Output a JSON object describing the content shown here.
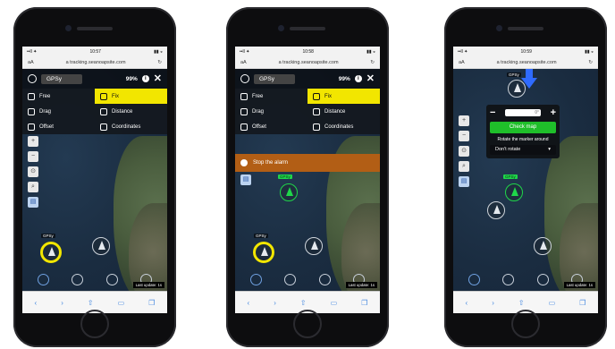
{
  "status_bar": {
    "carrier": "••ll ✦",
    "time": "10:57",
    "battery": "▮▮ ◒"
  },
  "status_bar_2": {
    "carrier": "••ll ✦",
    "time": "10:58",
    "battery": "▮▮ ◒"
  },
  "status_bar_3": {
    "carrier": "••ll ✦",
    "time": "10:59",
    "battery": "▮▮ ◒"
  },
  "url": {
    "aa": "aA",
    "text": "a tracking.seanoapsite.com",
    "reload": "↻"
  },
  "topbar": {
    "device": "GPSy",
    "battery": "99%",
    "info": "i",
    "close": "✕"
  },
  "menu": {
    "free": "Free",
    "fix": "Fix",
    "drag": "Drag",
    "distance": "Distance",
    "offset": "Offset",
    "coordinates": "Coordinates"
  },
  "banner": {
    "text": "Stop the alarm"
  },
  "vessel_labels": {
    "a": "GPSy",
    "b": "GPSy",
    "c": "GPSy",
    "d": "GPSy"
  },
  "zoom": {
    "minus": "−",
    "plus": "+",
    "value": "0°",
    "check": "Check map",
    "rotate_label": "Rotate the marker around",
    "rotate_value": "Don't rotate",
    "caret": "▾"
  },
  "last_update": "Last update: 1s",
  "safari": {
    "back": "‹",
    "fwd": "›",
    "share": "⇧",
    "book": "▭",
    "tabs": "❐"
  },
  "ctrl": {
    "plus": "+",
    "minus": "−",
    "loc": "⊙",
    "search": "⌕",
    "layer": "▤"
  }
}
